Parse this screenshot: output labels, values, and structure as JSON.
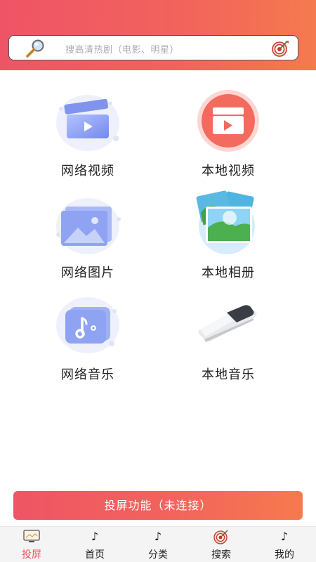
{
  "search": {
    "placeholder": "搜高清热剧（电影、明星）"
  },
  "grid": [
    {
      "label": "网络视频",
      "icon": "clapperboard-icon"
    },
    {
      "label": "本地视频",
      "icon": "video-play-icon"
    },
    {
      "label": "网络图片",
      "icon": "picture-icon"
    },
    {
      "label": "本地相册",
      "icon": "photo-album-icon"
    },
    {
      "label": "网络音乐",
      "icon": "music-note-icon"
    },
    {
      "label": "本地音乐",
      "icon": "phone-icon"
    }
  ],
  "cast_button": {
    "label": "投屏功能（未连接）"
  },
  "tabs": [
    {
      "label": "投屏",
      "icon": "screen-cast-icon",
      "active": true
    },
    {
      "label": "首页",
      "icon": "tiktok-icon",
      "active": false
    },
    {
      "label": "分类",
      "icon": "tiktok-icon",
      "active": false
    },
    {
      "label": "搜索",
      "icon": "target-icon",
      "active": false
    },
    {
      "label": "我的",
      "icon": "tiktok-icon",
      "active": false
    }
  ],
  "colors": {
    "accent": "#ef5466",
    "accent_end": "#f57a4f",
    "active_tab": "#ee4f5f"
  }
}
